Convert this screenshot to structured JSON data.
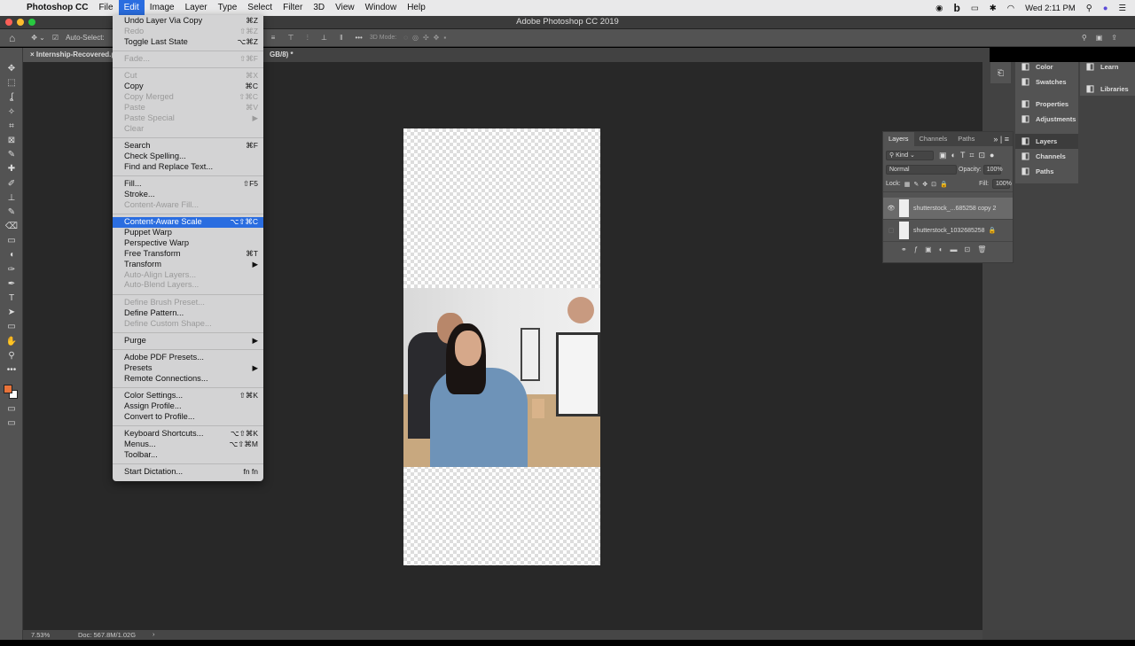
{
  "menubar": {
    "app": "Photoshop CC",
    "items": [
      "File",
      "Edit",
      "Image",
      "Layer",
      "Type",
      "Select",
      "Filter",
      "3D",
      "View",
      "Window",
      "Help"
    ],
    "active": "Edit",
    "clock": "Wed 2:11 PM"
  },
  "window": {
    "title": "Adobe Photoshop CC 2019"
  },
  "options": {
    "auto_select": "Auto-Select:",
    "mode_3d": "3D Mode:"
  },
  "tabs": [
    {
      "label": "Internship-Recovered.ps"
    },
    {
      "label": "GB/8) *"
    }
  ],
  "status": {
    "zoom": "7.53%",
    "doc": "Doc: 567.8M/1.02G",
    "arrow": "›"
  },
  "edit_menu": [
    [
      {
        "label": "Undo Layer Via Copy",
        "sc": "⌘Z"
      },
      {
        "label": "Redo",
        "sc": "⇧⌘Z",
        "disabled": true
      },
      {
        "label": "Toggle Last State",
        "sc": "⌥⌘Z"
      }
    ],
    [
      {
        "label": "Fade...",
        "sc": "⇧⌘F",
        "disabled": true
      }
    ],
    [
      {
        "label": "Cut",
        "sc": "⌘X",
        "disabled": true
      },
      {
        "label": "Copy",
        "sc": "⌘C"
      },
      {
        "label": "Copy Merged",
        "sc": "⇧⌘C",
        "disabled": true
      },
      {
        "label": "Paste",
        "sc": "⌘V",
        "disabled": true
      },
      {
        "label": "Paste Special",
        "sc": "▶",
        "disabled": true
      },
      {
        "label": "Clear",
        "sc": "",
        "disabled": true
      }
    ],
    [
      {
        "label": "Search",
        "sc": "⌘F"
      },
      {
        "label": "Check Spelling...",
        "sc": ""
      },
      {
        "label": "Find and Replace Text...",
        "sc": ""
      }
    ],
    [
      {
        "label": "Fill...",
        "sc": "⇧F5"
      },
      {
        "label": "Stroke...",
        "sc": ""
      },
      {
        "label": "Content-Aware Fill...",
        "sc": "",
        "disabled": true
      }
    ],
    [
      {
        "label": "Content-Aware Scale",
        "sc": "⌥⇧⌘C",
        "highlighted": true
      },
      {
        "label": "Puppet Warp",
        "sc": ""
      },
      {
        "label": "Perspective Warp",
        "sc": ""
      },
      {
        "label": "Free Transform",
        "sc": "⌘T"
      },
      {
        "label": "Transform",
        "sc": "▶"
      },
      {
        "label": "Auto-Align Layers...",
        "sc": "",
        "disabled": true
      },
      {
        "label": "Auto-Blend Layers...",
        "sc": "",
        "disabled": true
      }
    ],
    [
      {
        "label": "Define Brush Preset...",
        "sc": "",
        "disabled": true
      },
      {
        "label": "Define Pattern...",
        "sc": ""
      },
      {
        "label": "Define Custom Shape...",
        "sc": "",
        "disabled": true
      }
    ],
    [
      {
        "label": "Purge",
        "sc": "▶"
      }
    ],
    [
      {
        "label": "Adobe PDF Presets...",
        "sc": ""
      },
      {
        "label": "Presets",
        "sc": "▶"
      },
      {
        "label": "Remote Connections...",
        "sc": ""
      }
    ],
    [
      {
        "label": "Color Settings...",
        "sc": "⇧⌘K"
      },
      {
        "label": "Assign Profile...",
        "sc": ""
      },
      {
        "label": "Convert to Profile...",
        "sc": ""
      }
    ],
    [
      {
        "label": "Keyboard Shortcuts...",
        "sc": "⌥⇧⌘K"
      },
      {
        "label": "Menus...",
        "sc": "⌥⇧⌘M"
      },
      {
        "label": "Toolbar...",
        "sc": ""
      }
    ],
    [
      {
        "label": "Start Dictation...",
        "sc": "fn fn"
      }
    ]
  ],
  "panels_col1": [
    {
      "label": "Color",
      "icon": "color-icon"
    },
    {
      "label": "Swatches",
      "icon": "swatches-icon"
    },
    {
      "label": "Properties",
      "icon": "properties-icon"
    },
    {
      "label": "Adjustments",
      "icon": "adjustments-icon"
    },
    {
      "label": "Layers",
      "icon": "layers-icon"
    },
    {
      "label": "Channels",
      "icon": "channels-icon"
    },
    {
      "label": "Paths",
      "icon": "paths-icon"
    }
  ],
  "panels_col2": [
    {
      "label": "Learn",
      "icon": "learn-icon"
    },
    {
      "label": "Libraries",
      "icon": "libraries-icon"
    }
  ],
  "layers_panel": {
    "tabs": [
      "Layers",
      "Channels",
      "Paths"
    ],
    "filter": "Kind",
    "blend": "Normal",
    "opacity_label": "Opacity:",
    "opacity": "100%",
    "lock_label": "Lock:",
    "fill_label": "Fill:",
    "fill": "100%",
    "layers": [
      {
        "name": "shutterstock_...685258 copy 2",
        "visible": true,
        "selected": true
      },
      {
        "name": "shutterstock_1032685258",
        "visible": false,
        "locked": true
      }
    ]
  },
  "colors": {
    "foreground": "#e8733a",
    "background": "#ffffff",
    "accent": "#2a6de0"
  }
}
